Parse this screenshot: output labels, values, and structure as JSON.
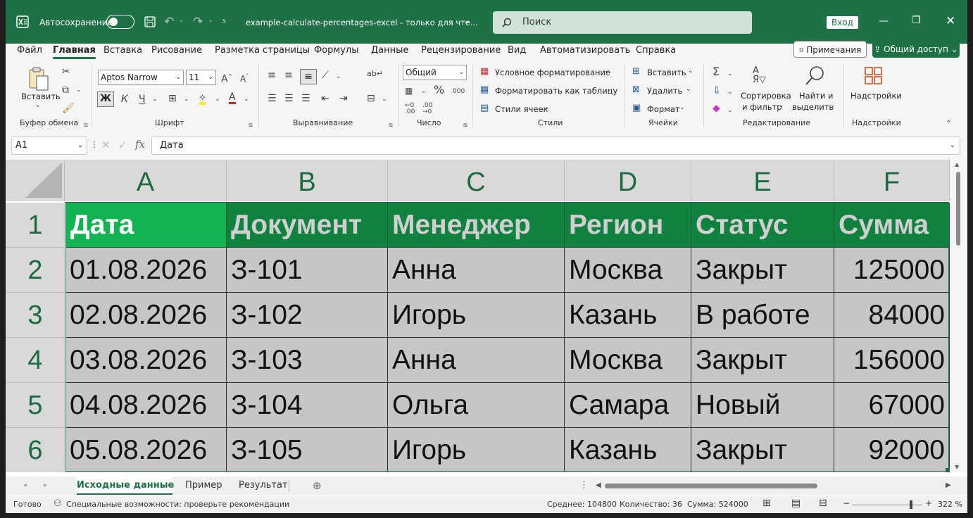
{
  "title_bar": {
    "autosave_label": "Автосохранение",
    "document_title": "example-calculate-percentages-excel  -  только для чте...",
    "search_placeholder": "Поиск",
    "signin_label": "Вход"
  },
  "menu": {
    "tabs": [
      "Файл",
      "Главная",
      "Вставка",
      "Рисование",
      "Разметка страницы",
      "Формулы",
      "Данные",
      "Рецензирование",
      "Вид",
      "Автоматизировать",
      "Справка"
    ],
    "active_tab": "Главная",
    "notes_label": "Примечания",
    "share_label": "Общий доступ"
  },
  "ribbon": {
    "paste_label": "Вставить",
    "clipboard_group": "Буфер обмена",
    "font_name": "Aptos Narrow",
    "font_size": "11",
    "font_group": "Шрифт",
    "bold": "Ж",
    "italic": "К",
    "underline": "Ч",
    "alignment_group": "Выравнивание",
    "number_format": "Общий",
    "number_group": "Число",
    "cond_format": "Условное форматирование",
    "format_table": "Форматировать как таблицу",
    "cell_styles": "Стили ячеек",
    "styles_group": "Стили",
    "insert": "Вставить",
    "delete": "Удалить",
    "format": "Формат",
    "cells_group": "Ячейки",
    "sort_filter_1": "Сортировка",
    "sort_filter_2": "и фильтр",
    "find_select_1": "Найти и",
    "find_select_2": "выделить",
    "editing_group": "Редактирование",
    "addins": "Надстройки",
    "addins_group": "Надстройки"
  },
  "formula_bar": {
    "name_box": "A1",
    "fx": "fx",
    "content": "Дата"
  },
  "sheet": {
    "columns": [
      "A",
      "B",
      "C",
      "D",
      "E",
      "F"
    ],
    "rows": [
      "1",
      "2",
      "3",
      "4",
      "5",
      "6"
    ],
    "header": [
      "Дата",
      "Документ",
      "Менеджер",
      "Регион",
      "Статус",
      "Сумма"
    ],
    "data": [
      [
        "01.08.2026",
        "З-101",
        "Анна",
        "Москва",
        "Закрыт",
        "125000"
      ],
      [
        "02.08.2026",
        "З-102",
        "Игорь",
        "Казань",
        "В работе",
        "84000"
      ],
      [
        "03.08.2026",
        "З-103",
        "Анна",
        "Москва",
        "Закрыт",
        "156000"
      ],
      [
        "04.08.2026",
        "З-104",
        "Ольга",
        "Самара",
        "Новый",
        "67000"
      ],
      [
        "05.08.2026",
        "З-105",
        "Игорь",
        "Казань",
        "Закрыт",
        "92000"
      ]
    ],
    "colors": {
      "header_fill": "#118140",
      "active_fill": "#12b351",
      "body_fill": "#c6c6c6"
    }
  },
  "sheet_tabs": [
    "Исходные данные",
    "Пример",
    "Результат"
  ],
  "active_sheet": "Исходные данные",
  "status_bar": {
    "ready": "Готово",
    "accessibility": "Специальные возможности: проверьте рекомендации",
    "average": "Среднее: 104800",
    "count": "Количество: 36",
    "sum": "Сумма: 524000",
    "zoom": "322 %"
  }
}
